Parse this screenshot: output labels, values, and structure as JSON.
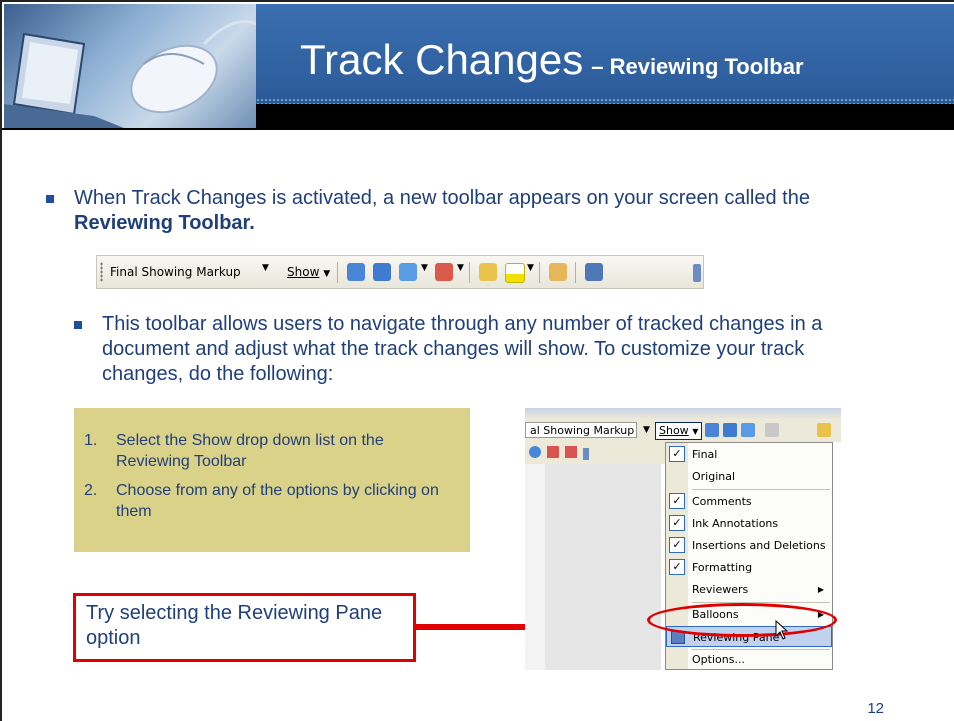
{
  "header": {
    "title_main": "Track Changes",
    "title_sub": "– Reviewing Toolbar"
  },
  "bullets": [
    {
      "text_before": "When Track Changes is activated, a new toolbar appears on your screen called the ",
      "text_bold": "Reviewing Toolbar."
    },
    {
      "text": "This toolbar allows users to navigate through any number of tracked changes in a document and adjust what the track changes will show. To customize your track changes, do the following:"
    }
  ],
  "toolbar": {
    "display_select": "Final Showing Markup",
    "show_label": "Show"
  },
  "steps": [
    {
      "num": "1.",
      "text": "Select the Show drop down list on the Reviewing Toolbar"
    },
    {
      "num": "2.",
      "text": "Choose from any of the options by clicking on them"
    }
  ],
  "callout": {
    "text": "Try selecting the Reviewing Pane option"
  },
  "screenshot": {
    "select_value": "al Showing Markup",
    "show_label": "Show",
    "menu_items": [
      {
        "label": "Final",
        "checked": true
      },
      {
        "label": "Original",
        "checked": false
      },
      {
        "label": "Comments",
        "checked": true
      },
      {
        "label": "Ink Annotations",
        "checked": true
      },
      {
        "label": "Insertions and Deletions",
        "checked": true
      },
      {
        "label": "Formatting",
        "checked": true
      },
      {
        "label": "Reviewers",
        "checked": false
      },
      {
        "label": "Balloons",
        "checked": false
      },
      {
        "label": "Reviewing Pane",
        "checked": false
      },
      {
        "label": "Options...",
        "checked": false
      }
    ]
  },
  "page_number": "12",
  "colors": {
    "title_bar": "#2f62a3",
    "text": "#1f3f7a",
    "steps_bg": "#dbd28a",
    "callout_border": "#e00000"
  }
}
